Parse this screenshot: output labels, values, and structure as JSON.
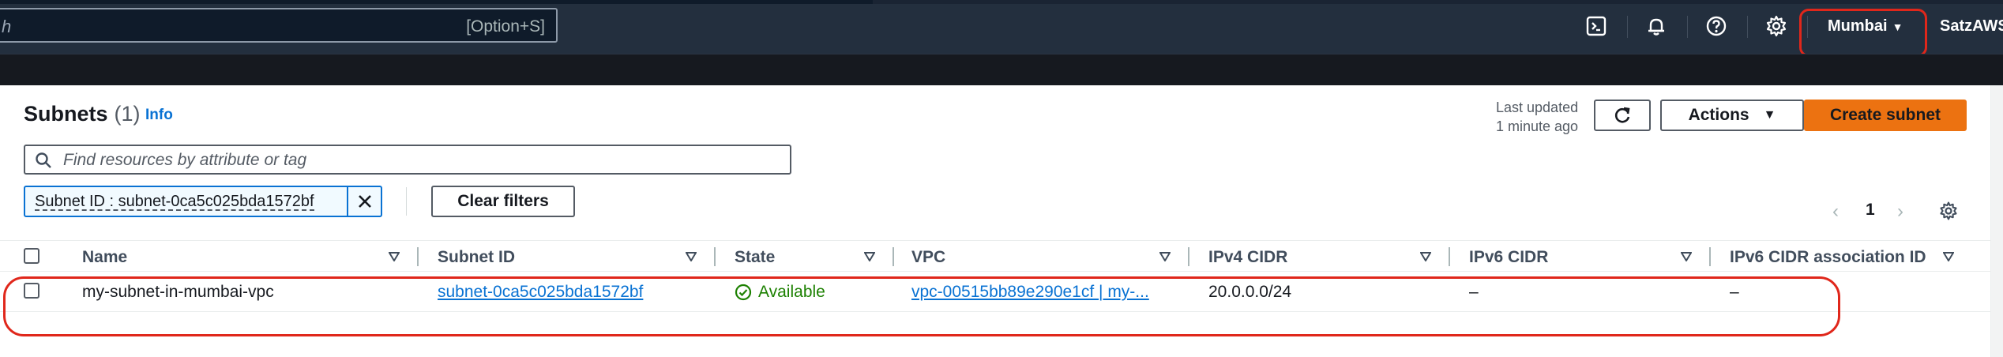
{
  "topnav": {
    "search_placeholder": "h",
    "search_shortcut": "[Option+S]",
    "icons": [
      "cloudshell-icon",
      "bell-icon",
      "help-icon",
      "gear-icon"
    ],
    "region": "Mumbai",
    "account": "SatzAWS"
  },
  "panel": {
    "title": "Subnets",
    "count": "(1)",
    "info": "Info",
    "last_updated_line1": "Last updated",
    "last_updated_line2": "1 minute ago",
    "actions_label": "Actions",
    "create_label": "Create subnet",
    "filter_placeholder": "Find resources by attribute or tag",
    "token_label": "Subnet ID : subnet-0ca5c025bda1572bf",
    "clear_filters": "Clear filters",
    "page_number": "1"
  },
  "table": {
    "columns": [
      "Name",
      "Subnet ID",
      "State",
      "VPC",
      "IPv4 CIDR",
      "IPv6 CIDR",
      "IPv6 CIDR association ID"
    ],
    "rows": [
      {
        "name": "my-subnet-in-mumbai-vpc",
        "subnet_id": "subnet-0ca5c025bda1572bf",
        "state": "Available",
        "vpc": "vpc-00515bb89e290e1cf | my-...",
        "ipv4": "20.0.0.0/24",
        "ipv6": "–",
        "ipv6_assoc": "–"
      }
    ]
  },
  "colors": {
    "nav_bg": "#232f3e",
    "primary": "#ec7211",
    "link": "#0972d3",
    "success": "#1d8102",
    "annotation": "#e0271b"
  }
}
